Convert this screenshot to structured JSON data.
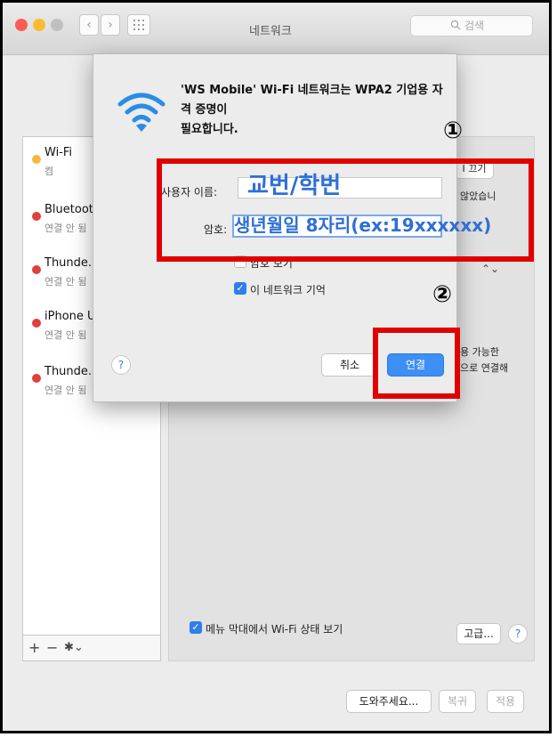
{
  "window": {
    "title": "네트워크",
    "search_placeholder": "검색",
    "nav_back": "‹",
    "nav_forward": "›",
    "grid_icon": "grid-icon",
    "traffic_lights": [
      "#fc5c57",
      "#fdbb2f",
      "#c0c0c0"
    ]
  },
  "sidebar": {
    "items": [
      {
        "name": "Wi-Fi",
        "status": "켬",
        "dot_color": "#f4b93c"
      },
      {
        "name": "Bluetooth I",
        "status": "연결 안 됨",
        "dot_color": "#e0403c"
      },
      {
        "name": "Thunde...th",
        "status": "연결 안 됨",
        "dot_color": "#e0403c"
      },
      {
        "name": "iPhone USI",
        "status": "연결 안 됨",
        "dot_color": "#e0403c"
      },
      {
        "name": "Thunde...lt",
        "status": "연결 안 됨",
        "dot_color": "#e0403c"
      }
    ],
    "add": "+",
    "remove": "−",
    "gear": "✱⌄"
  },
  "main": {
    "partial_button": "I 끄기",
    "partial_text_1": "않았습니",
    "partial_text_2": "용 가능한",
    "partial_text_3": "으로 연결해",
    "menu_bar_check_label": "메뉴 막대에서 Wi-Fi 상태 보기",
    "advanced_button": "고급...",
    "help": "?"
  },
  "footer": {
    "assist_button": "도와주세요...",
    "revert_button": "복귀",
    "apply_button": "적용"
  },
  "dialog": {
    "message_line1": "'WS Mobile' Wi-Fi 네트워크는 WPA2 기업용 자격 증명이",
    "message_line2": "필요합니다.",
    "username_label": "사용자 이름:",
    "password_label": "암호:",
    "show_password_label": "암호 보기",
    "remember_label": "이 네트워크 기억",
    "cancel_button": "취소",
    "connect_button": "연결",
    "help": "?"
  },
  "annotations": {
    "marker1": "①",
    "marker2": "②",
    "username_hint": "교번/학번",
    "password_hint": "생년월일 8자리(ex:19xxxxxx)",
    "highlight_color": "#e00000",
    "hint_color": "#2e6fd6"
  }
}
